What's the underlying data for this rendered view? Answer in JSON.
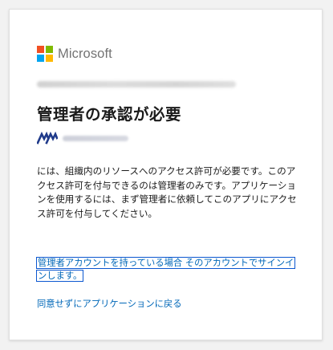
{
  "brand": {
    "name": "Microsoft",
    "logo_colors": [
      "#f25022",
      "#7fba00",
      "#00a4ef",
      "#ffb900"
    ]
  },
  "dialog": {
    "title": "管理者の承認が必要",
    "description": "には、組織内のリソースへのアクセス許可が必要です。このアクセス許可を付与できるのは管理者のみです。アプリケーションを使用するには、まず管理者に依頼してこのアプリにアクセス許可を付与してください。",
    "admin_signin_link": "管理者アカウントを持っている場合 そのアカウントでサインインします。",
    "return_link": "同意せずにアプリケーションに戻る"
  },
  "colors": {
    "link": "#0067b8",
    "focus_outline": "#0b57d0",
    "app_icon": "#1f3a8a"
  }
}
